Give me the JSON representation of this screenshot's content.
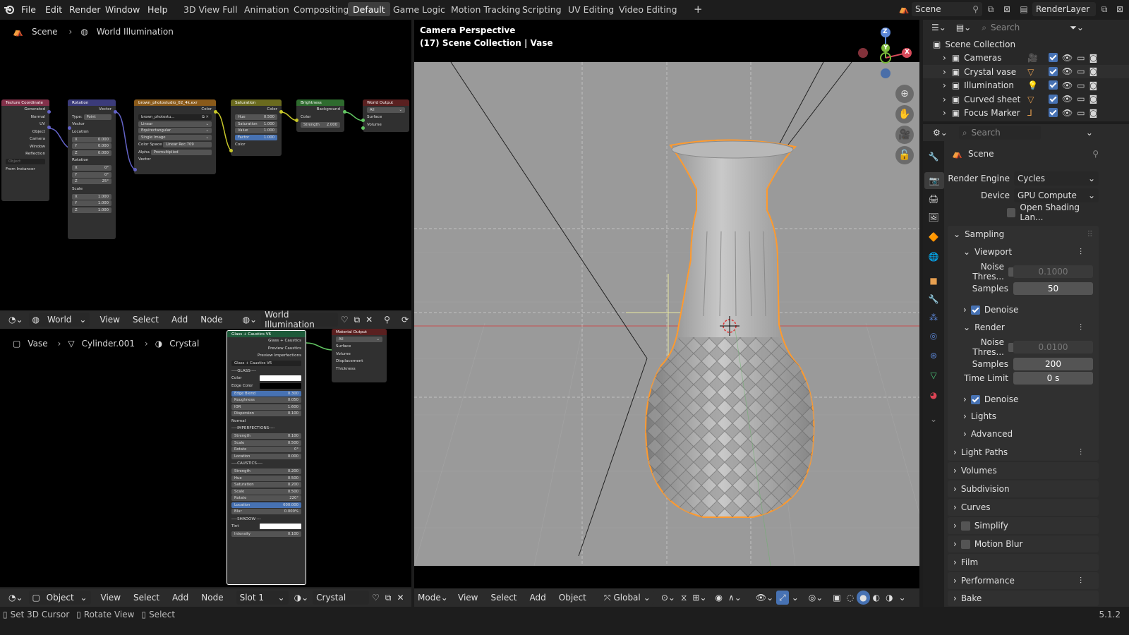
{
  "topbar": {
    "menus": [
      "File",
      "Edit",
      "Render",
      "Window",
      "Help"
    ],
    "workspaces": [
      "3D View Full",
      "Animation",
      "Compositing",
      "Default",
      "Game Logic",
      "Motion Tracking",
      "Scripting",
      "UV Editing",
      "Video Editing"
    ],
    "active_workspace": "Default",
    "scene_name": "Scene",
    "view_layer": "RenderLayer"
  },
  "world_editor": {
    "breadcrumb": [
      "Scene",
      "World Illumination"
    ],
    "header": {
      "editor_type": "World",
      "menus": [
        "View",
        "Select",
        "Add",
        "Node"
      ],
      "datablock": "World Illumination"
    },
    "nodes": {
      "texcoord": {
        "title": "Texture Coordinate",
        "outputs": [
          "Generated",
          "Normal",
          "UV",
          "Object",
          "Camera",
          "Window",
          "Reflection"
        ],
        "object_placeholder": "Object",
        "from_instancer": "From Instancer"
      },
      "mapping": {
        "title": "Rotation",
        "out": "Vector",
        "type_label": "Type:",
        "type_value": "Point",
        "in_vector": "Vector",
        "location": "Location",
        "rotation": "Rotation",
        "scale": "Scale",
        "axes": [
          "X",
          "Y",
          "Z"
        ],
        "loc_values": [
          "0.000",
          "0.000",
          "0.000"
        ],
        "rot_values": [
          "0°",
          "0°",
          "25°"
        ],
        "scale_values": [
          "1.000",
          "1.000",
          "1.000"
        ]
      },
      "envtex": {
        "title": "brown_photostudio_02_4k.exr",
        "out": "Color",
        "image": "brown_photostu...",
        "interp": "Linear",
        "proj": "Equirectangular",
        "src": "Single Image",
        "cs_label": "Color Space",
        "cs_value": "Linear Rec.709",
        "alpha_label": "Alpha",
        "alpha_value": "Premultiplied",
        "in_vector": "Vector"
      },
      "saturation": {
        "title": "Saturation",
        "out": "Color",
        "fields": [
          [
            "Hue",
            "0.500"
          ],
          [
            "Saturation",
            "1.000"
          ],
          [
            "Value",
            "1.000"
          ],
          [
            "Factor",
            "1.000"
          ]
        ],
        "in_color": "Color"
      },
      "brightness": {
        "title": "Brightness",
        "out": "Background",
        "in_color": "Color",
        "strength_label": "Strength",
        "strength_value": "2.000"
      },
      "worldout": {
        "title": "World Output",
        "target": "All",
        "inputs": [
          "Surface",
          "Volume"
        ]
      }
    }
  },
  "material_editor": {
    "breadcrumb": [
      "Vase",
      "Cylinder.001",
      "Crystal"
    ],
    "header": {
      "mode": "Object",
      "menus": [
        "View",
        "Select",
        "Add",
        "Node"
      ],
      "slot": "Slot 1",
      "material": "Crystal"
    },
    "glass_node": {
      "title": "Glass + Caustics V6",
      "outputs": [
        "Glass + Caustics",
        "Preview Caustics",
        "Preview Imperfections"
      ],
      "group": "Glass + Caustics V6",
      "sec_glass": "----GLASS----",
      "glass_fields": [
        [
          "Edge Blend",
          "0.300"
        ],
        [
          "Roughness",
          "0.050"
        ],
        [
          "IOR",
          "1.600"
        ],
        [
          "Dispersion",
          "0.100"
        ]
      ],
      "color_label": "Color",
      "edge_color_label": "Edge Color",
      "normal_label": "Normal",
      "sec_imp": "----IMPERFECTIONS----",
      "imp_fields": [
        [
          "Strength",
          "0.100"
        ],
        [
          "Scale",
          "0.500"
        ],
        [
          "Rotate",
          "0°"
        ],
        [
          "Location",
          "0.000"
        ]
      ],
      "sec_caus": "----CAUSTICS----",
      "caus_fields": [
        [
          "Strength",
          "0.200"
        ],
        [
          "Hue",
          "0.500"
        ],
        [
          "Saturation",
          "0.200"
        ],
        [
          "Scale",
          "0.500"
        ],
        [
          "Rotate",
          "220°"
        ],
        [
          "Location",
          "600.000"
        ],
        [
          "Blur",
          "0.000%"
        ]
      ],
      "sec_shadow": "----SHADOW----",
      "tint_label": "Tint",
      "intensity": [
        "Intensity",
        "0.100"
      ]
    },
    "matout": {
      "title": "Material Output",
      "target": "All",
      "inputs": [
        "Surface",
        "Volume",
        "Displacement",
        "Thickness"
      ]
    }
  },
  "viewport": {
    "title": "Camera Perspective",
    "subtitle": "(17) Scene Collection | Vase",
    "header": {
      "mode": "Mode",
      "menus": [
        "View",
        "Select",
        "Add",
        "Object"
      ],
      "orientation": "Global"
    },
    "gizmo": {
      "z": "Z",
      "y": "Y",
      "x": "X"
    }
  },
  "outliner": {
    "search_placeholder": "Search",
    "root": "Scene Collection",
    "items": [
      "Cameras",
      "Crystal vase",
      "Illumination",
      "Curved sheet",
      "Focus Marker"
    ]
  },
  "properties": {
    "search_placeholder": "Search",
    "context": "Scene",
    "render_engine_label": "Render Engine",
    "render_engine": "Cycles",
    "device_label": "Device",
    "device": "GPU Compute",
    "osl_label": "Open Shading Lan...",
    "sampling": "Sampling",
    "viewport": "Viewport",
    "noise_label": "Noise Thres...",
    "vp_noise": "0.1000",
    "samples_label": "Samples",
    "vp_samples": "50",
    "denoise": "Denoise",
    "render": "Render",
    "r_noise": "0.0100",
    "r_samples": "200",
    "time_limit_label": "Time Limit",
    "time_limit": "0 s",
    "lights": "Lights",
    "advanced": "Advanced",
    "panels": [
      "Light Paths",
      "Volumes",
      "Subdivision",
      "Curves",
      "Simplify",
      "Motion Blur",
      "Film",
      "Performance",
      "Bake"
    ]
  },
  "status": {
    "items": [
      "Set 3D Cursor",
      "Rotate View",
      "Select"
    ],
    "version": "5.1.2"
  },
  "colors": {
    "accent": "#4772b3",
    "selection": "#ff9a2e",
    "active_tab": "#3d3d3d"
  }
}
